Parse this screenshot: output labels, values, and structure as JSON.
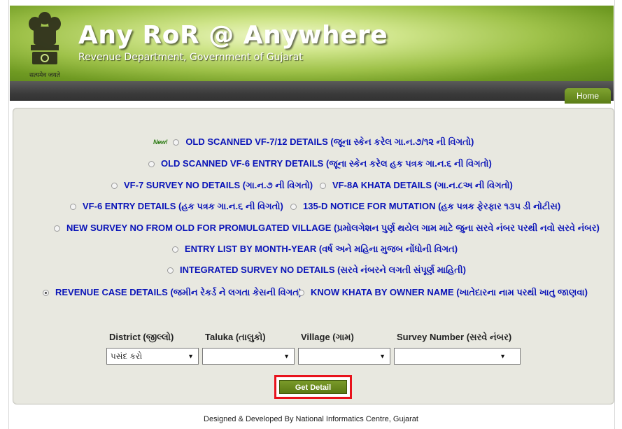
{
  "header": {
    "title": "Any RoR @ Anywhere",
    "subtitle": "Revenue Department, Government of Gujarat",
    "motto": "सत्यमेव जयते",
    "brand_color": "#7fa330"
  },
  "nav": {
    "home_label": "Home"
  },
  "options": {
    "new_badge": "New!",
    "o1": "OLD SCANNED VF-7/12 DETAILS (જૂના સ્કેન કરેલ ગા.ન.૭/૧૨ ની વિગતો)",
    "o2": "OLD SCANNED VF-6 ENTRY DETAILS (જૂના સ્કેન કરેલ હક પત્રક ગા.ન.૬ ની વિગતો)",
    "o3": "VF-7 SURVEY NO DETAILS (ગા.ન.૭ ની વિગતો)",
    "o4": "VF-8A KHATA DETAILS (ગા.ન.૮અ ની વિગતો)",
    "o5": "VF-6 ENTRY DETAILS (હક પત્રક ગા.ન.૬ ની વિગતો)",
    "o6": "135-D NOTICE FOR MUTATION (હક પત્રક ફેરફાર ૧૩૫ ડી નોટીસ)",
    "o7": "NEW SURVEY NO FROM OLD FOR PROMULGATED VILLAGE (પ્રમોલગેશન પુર્ણ થયેલ ગામ માટે જુના સરવે નંબર પરથી નવો સરવે નંબર)",
    "o8": "ENTRY LIST BY MONTH-YEAR (વર્ષ અને મહિના મુજબ નોંધોની વિગત)",
    "o9": "INTEGRATED SURVEY NO DETAILS (સરવે નંબરને લગતી સંપૂર્ણ માહિતી)",
    "o10": "REVENUE CASE DETAILS (જમીન રેકર્ડ ને લગતા કેસની વિગત)",
    "o11": "KNOW KHATA BY OWNER NAME (ખાતેદારના નામ પરથી ખાતુ જાણવા)",
    "selected": "o10"
  },
  "form": {
    "district_label": "District (જીલ્લો)",
    "taluka_label": "Taluka (તાલુકો)",
    "village_label": "Village (ગામ)",
    "survey_label": "Survey Number (સરવે નંબર)",
    "district_value": "પસંદ કરો",
    "taluka_value": "",
    "village_value": "",
    "survey_value": "",
    "submit_label": "Get Detail"
  },
  "footer": {
    "text": "Designed & Developed By National Informatics Centre, Gujarat"
  }
}
